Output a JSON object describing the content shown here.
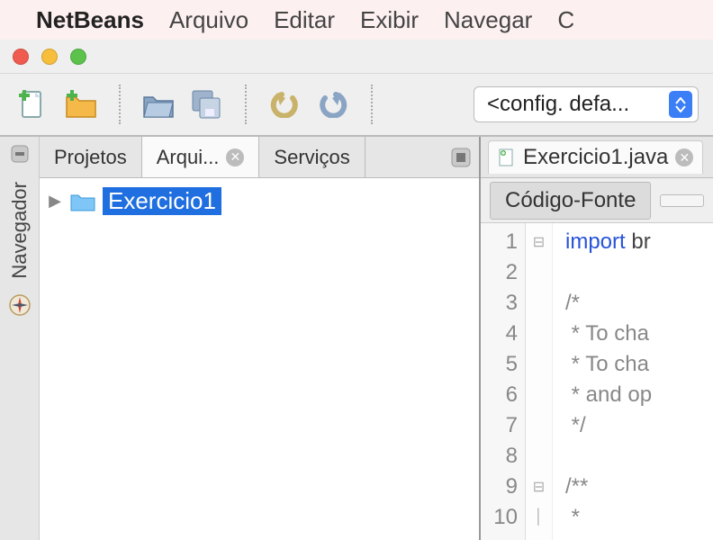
{
  "mac_menu": {
    "app_name": "NetBeans",
    "items": [
      "Arquivo",
      "Editar",
      "Exibir",
      "Navegar",
      "C"
    ]
  },
  "toolbar": {
    "config_label": "<config. defa..."
  },
  "rail": {
    "label": "Navegador"
  },
  "left_panel": {
    "tabs": [
      "Projetos",
      "Arqui...",
      "Serviços"
    ],
    "active_tab_index": 1,
    "tree": {
      "root_label": "Exercicio1"
    }
  },
  "editor": {
    "tab_label": "Exercicio1.java",
    "subtab_label": "Código-Fonte",
    "lines": {
      "l1_keyword": "import",
      "l1_rest": " br",
      "l2": "",
      "l3": "/*",
      "l4": " * To cha",
      "l5": " * To cha",
      "l6": " * and op",
      "l7": " */",
      "l8": "",
      "l9": "/**",
      "l10": " *"
    },
    "line_numbers": [
      "1",
      "2",
      "3",
      "4",
      "5",
      "6",
      "7",
      "8",
      "9",
      "10"
    ]
  }
}
